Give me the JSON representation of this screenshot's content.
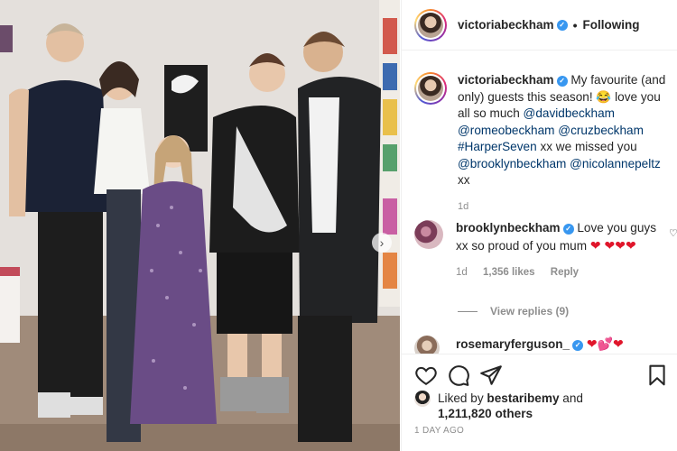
{
  "post": {
    "username": "victoriabeckham",
    "follow_status": "Following",
    "dot": "•"
  },
  "caption": {
    "username": "victoriabeckham",
    "text_1": "My favourite (and only) guests this season!",
    "emoji_1": "😂",
    "text_2": "love you all so much",
    "mention_1": "@davidbeckham",
    "mention_2": "@romeobeckham",
    "mention_3": "@cruzbeckham",
    "hashtag_1": "#HarperSeven",
    "text_3": "xx we missed you",
    "mention_4": "@brooklynbeckham",
    "mention_5": "@nicolannepeltz",
    "text_4": "xx",
    "age": "1d"
  },
  "comments": [
    {
      "username": "brooklynbeckham",
      "text": "Love you guys xx so proud of you mum",
      "hearts": "❤ ❤❤❤",
      "age": "1d",
      "likes": "1,356 likes",
      "reply": "Reply",
      "view_replies": "View replies (9)"
    },
    {
      "username": "rosemaryferguson_",
      "hearts": "❤💕❤"
    }
  ],
  "likes": {
    "prefix": "Liked by",
    "user": "bestaribemy",
    "joiner": "and",
    "others": "1,211,820 others"
  },
  "timestamp": "1 DAY AGO",
  "icons": {
    "like": "heart-outline-icon",
    "comment": "comment-bubble-icon",
    "share": "paper-plane-icon",
    "save": "bookmark-icon",
    "verified": "verified-badge-icon",
    "next": "chevron-right-icon"
  },
  "colors": {
    "link": "#00376b",
    "verified": "#3897f0",
    "muted": "#8e8e8e",
    "heart": "#e0162b"
  }
}
